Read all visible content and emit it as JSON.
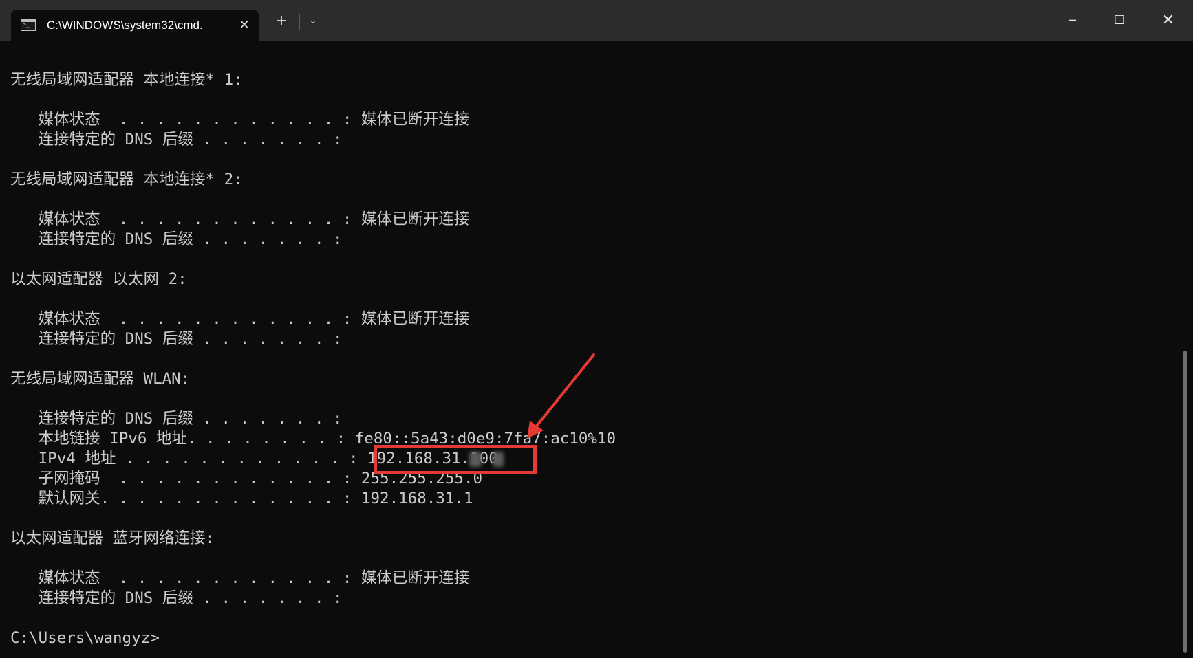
{
  "window": {
    "tab_title": "C:\\WINDOWS\\system32\\cmd.",
    "tab_close_icon": "✕",
    "new_tab_icon": "+",
    "dropdown_icon": "⌄",
    "minimize_icon": "─",
    "maximize_icon": "☐",
    "close_icon": "✕"
  },
  "colors": {
    "terminal_background": "#0c0c0c",
    "terminal_text": "#cccccc",
    "annotation_red": "#e53935"
  },
  "terminal": {
    "lines": [
      "无线局域网适配器 本地连接* 1:",
      "",
      "   媒体状态  . . . . . . . . . . . . : 媒体已断开连接",
      "   连接特定的 DNS 后缀 . . . . . . . :",
      "",
      "无线局域网适配器 本地连接* 2:",
      "",
      "   媒体状态  . . . . . . . . . . . . : 媒体已断开连接",
      "   连接特定的 DNS 后缀 . . . . . . . :",
      "",
      "以太网适配器 以太网 2:",
      "",
      "   媒体状态  . . . . . . . . . . . . : 媒体已断开连接",
      "   连接特定的 DNS 后缀 . . . . . . . :",
      "",
      "无线局域网适配器 WLAN:",
      "",
      "   连接特定的 DNS 后缀 . . . . . . . :",
      "   本地链接 IPv6 地址. . . . . . . . : fe80::5a43:d0e9:7fa7:ac10%10",
      "   IPv4 地址 . . . . . . . . . . . . : 192.168.31.100",
      "   子网掩码  . . . . . . . . . . . . : 255.255.255.0",
      "   默认网关. . . . . . . . . . . . . : 192.168.31.1",
      "",
      "以太网适配器 蓝牙网络连接:",
      "",
      "   媒体状态  . . . . . . . . . . . . : 媒体已断开连接",
      "   连接特定的 DNS 后缀 . . . . . . . :",
      "",
      "C:\\Users\\wangyz>"
    ]
  }
}
